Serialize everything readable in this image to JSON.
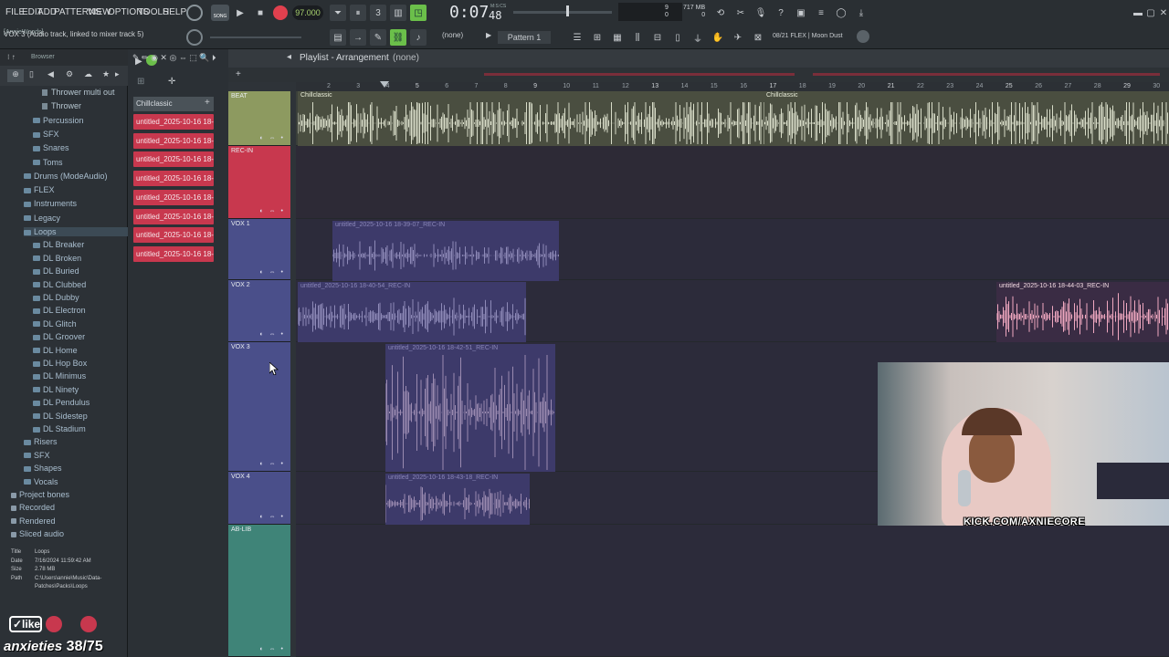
{
  "menu": [
    "FILE",
    "EDIT",
    "ADD",
    "PATTERNS",
    "VIEW",
    "OPTIONS",
    "TOOLS",
    "HELP"
  ],
  "transport": {
    "tempo": "97.000",
    "time": "0:07",
    "time_sub": "48",
    "time_units": "M:S:CS",
    "mode": "SONG"
  },
  "hint": {
    "user": "[AnnieWoods]",
    "text": "VOX 3 (Audio track, linked to mixer track 5)"
  },
  "toolbar": {
    "pattern": "Pattern 1",
    "none": "(none)",
    "plugin": "08/21  FLEX | Moon Dust",
    "mem": "717 MB",
    "mem_sub": "0",
    "cpu": "9",
    "cpu_sub": "0"
  },
  "browser": {
    "title": "Browser",
    "items": [
      {
        "label": "Thrower multi out",
        "type": "file",
        "indent": 2
      },
      {
        "label": "Thrower",
        "type": "file",
        "indent": 2
      },
      {
        "label": "Percussion",
        "type": "folder",
        "indent": 1
      },
      {
        "label": "SFX",
        "type": "folder",
        "indent": 1
      },
      {
        "label": "Snares",
        "type": "folder",
        "indent": 1
      },
      {
        "label": "Toms",
        "type": "folder",
        "indent": 1
      },
      {
        "label": "Drums (ModeAudio)",
        "type": "folder",
        "indent": 0
      },
      {
        "label": "FLEX",
        "type": "folder",
        "indent": 0
      },
      {
        "label": "Instruments",
        "type": "folder",
        "indent": 0
      },
      {
        "label": "Legacy",
        "type": "folder",
        "indent": 0
      },
      {
        "label": "Loops",
        "type": "folder",
        "indent": 0
      },
      {
        "label": "DL Breaker",
        "type": "folder",
        "indent": 1
      },
      {
        "label": "DL Broken",
        "type": "folder",
        "indent": 1
      },
      {
        "label": "DL Buried",
        "type": "folder",
        "indent": 1
      },
      {
        "label": "DL Clubbed",
        "type": "folder",
        "indent": 1
      },
      {
        "label": "DL Dubby",
        "type": "folder",
        "indent": 1
      },
      {
        "label": "DL Electron",
        "type": "folder",
        "indent": 1
      },
      {
        "label": "DL Glitch",
        "type": "folder",
        "indent": 1
      },
      {
        "label": "DL Groover",
        "type": "folder",
        "indent": 1
      },
      {
        "label": "DL Home",
        "type": "folder",
        "indent": 1
      },
      {
        "label": "DL Hop Box",
        "type": "folder",
        "indent": 1
      },
      {
        "label": "DL Minimus",
        "type": "folder",
        "indent": 1
      },
      {
        "label": "DL Ninety",
        "type": "folder",
        "indent": 1
      },
      {
        "label": "DL Pendulus",
        "type": "folder",
        "indent": 1
      },
      {
        "label": "DL Sidestep",
        "type": "folder",
        "indent": 1
      },
      {
        "label": "DL Stadium",
        "type": "folder",
        "indent": 1
      },
      {
        "label": "Risers",
        "type": "folder",
        "indent": 0
      },
      {
        "label": "SFX",
        "type": "folder",
        "indent": 0
      },
      {
        "label": "Shapes",
        "type": "folder",
        "indent": 0
      },
      {
        "label": "Vocals",
        "type": "folder",
        "indent": 0
      },
      {
        "label": "Project bones",
        "type": "special",
        "indent": -1
      },
      {
        "label": "Recorded",
        "type": "special",
        "indent": -1
      },
      {
        "label": "Rendered",
        "type": "special",
        "indent": -1
      },
      {
        "label": "Sliced audio",
        "type": "special",
        "indent": -1
      }
    ],
    "info": [
      {
        "k": "Title",
        "v": "Loops"
      },
      {
        "k": "Date",
        "v": "7/16/2024 11:59:42 AM"
      },
      {
        "k": "Size",
        "v": "2.78 MB"
      },
      {
        "k": "Path",
        "v": "C:\\Users\\annie\\Music\\Data-"
      },
      {
        "k": "",
        "v": "Patches\\Packs\\Loops"
      }
    ]
  },
  "clips_panel": {
    "header": "Chillclassic",
    "items": [
      "untitled_2025-10-16 18-",
      "untitled_2025-10-16 18-",
      "untitled_2025-10-16 18-",
      "untitled_2025-10-16 18-",
      "untitled_2025-10-16 18-",
      "untitled_2025-10-16 18-",
      "untitled_2025-10-16 18-",
      "untitled_2025-10-16 18-"
    ]
  },
  "playlist": {
    "title": "Playlist - Arrangement",
    "subtitle": "(none)",
    "ruler": [
      "2",
      "3",
      "4",
      "5",
      "6",
      "7",
      "8",
      "9",
      "10",
      "11",
      "12",
      "13",
      "14",
      "15",
      "16",
      "17",
      "18",
      "19",
      "20",
      "21",
      "22",
      "23",
      "24",
      "25",
      "26",
      "27",
      "28",
      "29",
      "30"
    ],
    "tracks": [
      {
        "name": "BEAT",
        "color": "#8d9a60"
      },
      {
        "name": "REC-IN",
        "color": "#c8384e"
      },
      {
        "name": "VOX 1",
        "color": "#4a4f8a"
      },
      {
        "name": "VOX 2",
        "color": "#4a4f8a"
      },
      {
        "name": "VOX 3",
        "color": "#4a4f8a"
      },
      {
        "name": "VOX 4",
        "color": "#4a4f8a"
      },
      {
        "name": "AB-LIB",
        "color": "#3f8478"
      }
    ],
    "clips": {
      "beat1": "Chillclassic",
      "beat2": "Chillclassic",
      "vox1": "untitled_2025-10-16 18-39-07_REC-IN",
      "vox2": "untitled_2025-10-16 18-40-54_REC-IN",
      "vox2b": "untitled_2025-10-16 18-44-03_REC-IN",
      "vox3": "untitled_2025-10-16 18-42-51_REC-IN",
      "vox4": "untitled_2025-10-16 18-43-18_REC-IN"
    }
  },
  "overlay": {
    "caption": "KICK.COM/AXNIECORE",
    "counter": "38/75"
  },
  "colors": {
    "accent": "#6bbf4a",
    "rec": "#c8384e",
    "vox": "#4a4f8a"
  }
}
